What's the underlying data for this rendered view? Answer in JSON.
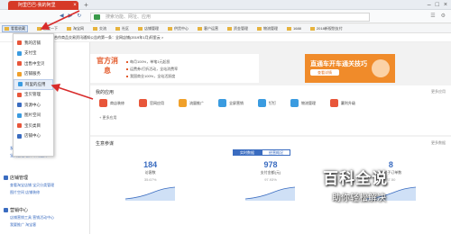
{
  "browser": {
    "tab_title": "阿里巴巴-我的阿里",
    "address": "搜索功能、网址、应用",
    "bookmarks": [
      "看看收藏",
      "百度一下",
      "淘宝网",
      "交流",
      "社区",
      "店铺管理",
      "供货中心",
      "客户运营",
      "资金管理",
      "物流管理",
      "1688",
      "2018新规划支付"
    ],
    "notice": "合作商品交易资讯通知公告的第一条：全网店铺(2019年1月)阿里云 >"
  },
  "menu": {
    "items": [
      "我的店铺",
      "支付宝",
      "出售中宝贝",
      "店铺服务",
      "阿里的应用",
      "宝贝管理",
      "资源中心",
      "图片空间",
      "宝贝类目",
      "店铺中心"
    ]
  },
  "left_nav": {
    "groups": [
      {
        "title": "店铺管理",
        "rows": [
          "查看淘宝店铺  宝贝分类管理",
          "图片空间  店铺装修"
        ]
      },
      {
        "title": "营销中心",
        "rows": [
          "店铺营销工具  营销活动中心",
          "我要推广  淘宝客"
        ]
      }
    ],
    "stray_rows": [
      "发布宝贝  出售中的宝贝",
      "宝贝管理  仓库中的宝贝"
    ]
  },
  "banner": {
    "logo": "官方消息",
    "lines": [
      "每月100%，单笔1元起投",
      "运费券/打折活动，全站消费率",
      "我国商业100%，全站活跃度",
      "飞猪全新的服务"
    ],
    "promo_title": "直通车开车通关技巧",
    "promo_button": "查看详情"
  },
  "my_apps": {
    "title": "我的应用",
    "more": "更多应用",
    "items": [
      {
        "name": "商店装修",
        "color": "#e8563a"
      },
      {
        "name": "官网应用",
        "color": "#e8563a"
      },
      {
        "name": "流量推广",
        "color": "#f0a02a"
      },
      {
        "name": "全屏营销",
        "color": "#3a9be0"
      },
      {
        "name": "钉钉",
        "color": "#3a9be0"
      },
      {
        "name": "物流管理",
        "color": "#3a9be0"
      },
      {
        "name": "赢利升级",
        "color": "#e8563a"
      }
    ],
    "add_label": "+ 更多应用"
  },
  "business": {
    "title": "生意参谋",
    "more": "更多数据",
    "tabs": [
      "实时数据",
      "经营概况"
    ],
    "stats": [
      {
        "value": "184",
        "label": "访客数",
        "pct": "35.67%"
      },
      {
        "value": "978",
        "label": "支付金额(元)",
        "pct": "97.93%"
      },
      {
        "value": "8",
        "label": "支付子订单数",
        "pct": "87.50"
      }
    ]
  },
  "watermark": {
    "big": "百科全说",
    "small": "助你轻松解决"
  }
}
